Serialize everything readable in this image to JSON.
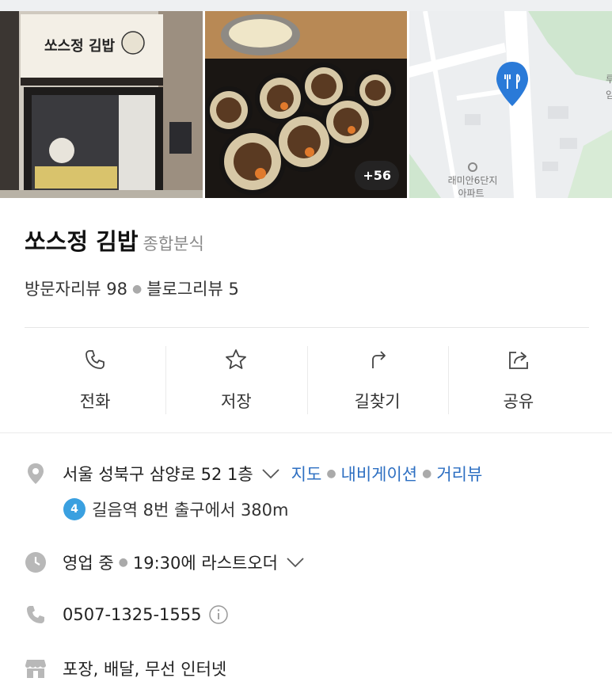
{
  "photos": {
    "storefront_sign": "쏘스정 김밥",
    "more_count": "+56",
    "map_label": "래미안6단지\n아파트"
  },
  "place": {
    "name": "쏘스정 김밥",
    "category": "종합분식",
    "visitor_review": "방문자리뷰 98",
    "blog_review": "블로그리뷰 5"
  },
  "actions": [
    {
      "label": "전화",
      "icon": "phone-icon"
    },
    {
      "label": "저장",
      "icon": "star-icon"
    },
    {
      "label": "길찾기",
      "icon": "directions-icon"
    },
    {
      "label": "공유",
      "icon": "share-icon"
    }
  ],
  "address": {
    "text": "서울 성북구 삼양로 52 1층",
    "map_link": "지도",
    "navi_link": "내비게이션",
    "street_link": "거리뷰",
    "subway_line": "4",
    "subway_text": "길음역 8번 출구에서 380m"
  },
  "hours": {
    "status": "영업 중",
    "last_order": "19:30에 라스트오더"
  },
  "phone": "0507-1325-1555",
  "amenities": "포장, 배달, 무선 인터넷",
  "colors": {
    "link": "#2d6fc2",
    "map_pin": "#2a7ad8",
    "subway_line4": "#3aa0e0"
  }
}
